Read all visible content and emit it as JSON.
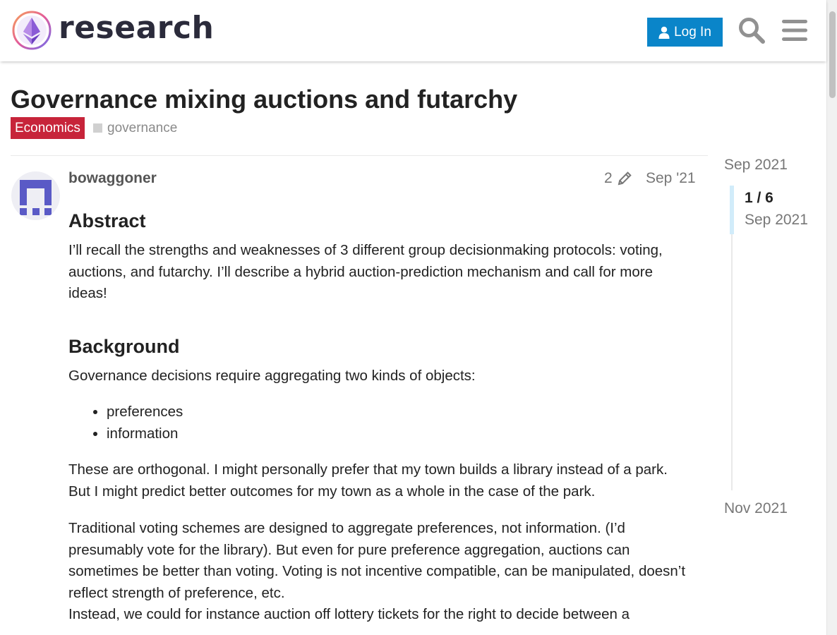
{
  "header": {
    "logo_text": "research",
    "login_label": "Log In",
    "accent_color": "#0a85c9"
  },
  "topic": {
    "title": "Governance mixing auctions and futarchy",
    "category": "Economics",
    "category_color": "#c7243a",
    "tags": [
      "governance"
    ]
  },
  "post": {
    "username": "bowaggoner",
    "edit_count": "2",
    "date": "Sep '21",
    "abstract_heading": "Abstract",
    "abstract_text": "I’ll recall the strengths and weaknesses of 3 different group decisionmaking protocols: voting, auctions, and futarchy. I’ll describe a hybrid auction-prediction mechanism and call for more ideas!",
    "background_heading": "Background",
    "background_intro": "Governance decisions require aggregating two kinds of objects:",
    "background_list": [
      "preferences",
      "information"
    ],
    "orthogonal_text": "These are orthogonal. I might personally prefer that my town builds a library instead of a park. But I might predict better outcomes for my town as a whole in the case of the park.",
    "voting_text": "Traditional voting schemes are designed to aggregate preferences, not information. (I’d presumably vote for the library). But even for pure preference aggregation, auctions can sometimes be better than voting. Voting is not incentive compatible, can be manipulated, doesn’t reflect strength of preference, etc.",
    "instead_text": "Instead, we could for instance auction off lottery tickets for the right to decide between a"
  },
  "timeline": {
    "start_label": "Sep 2021",
    "position": "1 / 6",
    "position_date": "Sep 2021",
    "end_label": "Nov 2021",
    "progress_fraction": 0.1667
  }
}
